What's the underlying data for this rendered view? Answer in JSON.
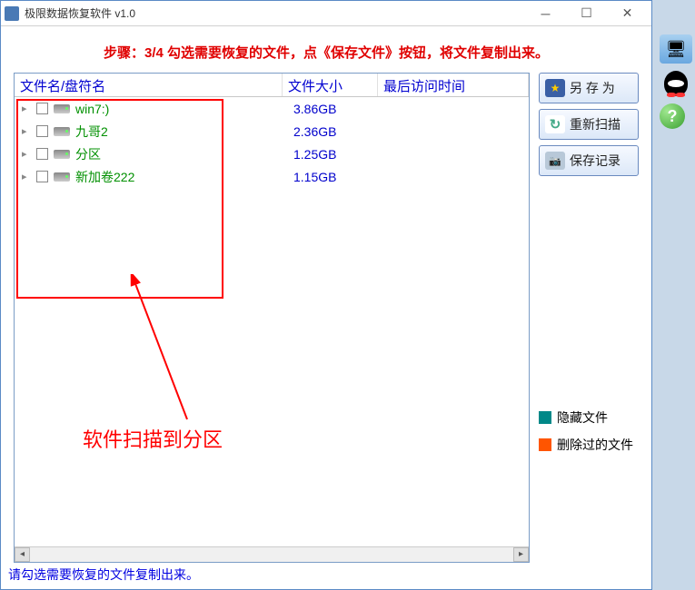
{
  "window": {
    "title": "极限数据恢复软件 v1.0"
  },
  "step_message": "步骤：3/4 勾选需要恢复的文件，点《保存文件》按钮，将文件复制出来。",
  "columns": {
    "name": "文件名/盘符名",
    "size": "文件大小",
    "time": "最后访问时间"
  },
  "rows": [
    {
      "name": "win7:)",
      "size": "3.86GB"
    },
    {
      "name": "九哥2",
      "size": "2.36GB"
    },
    {
      "name": "分区",
      "size": "1.25GB"
    },
    {
      "name": "新加卷222",
      "size": "1.15GB"
    }
  ],
  "buttons": {
    "save_as": "另 存 为",
    "rescan": "重新扫描",
    "save_log": "保存记录"
  },
  "legend": {
    "hidden": "隐藏文件",
    "deleted": "删除过的文件"
  },
  "annotation": "软件扫描到分区",
  "status_bar": "请勾选需要恢复的文件复制出来。"
}
